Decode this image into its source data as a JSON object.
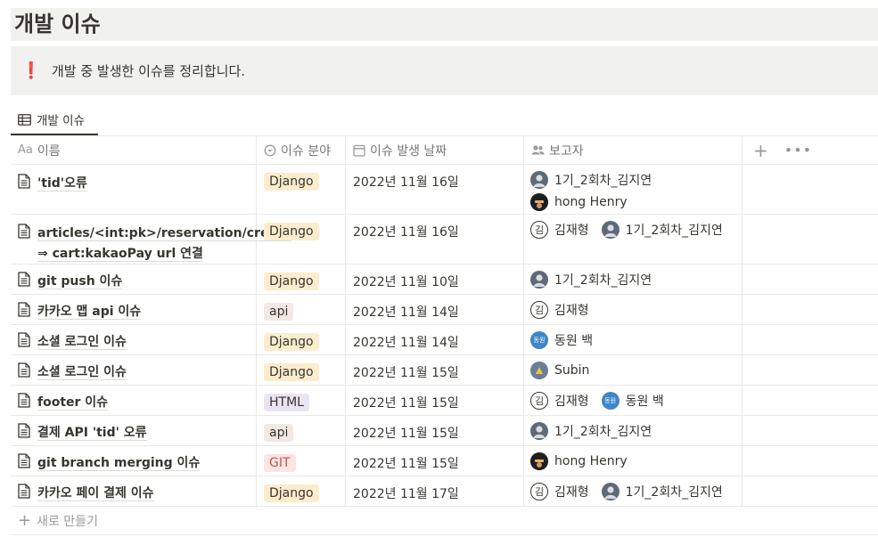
{
  "page": {
    "title": "개발 이슈"
  },
  "callout": {
    "emoji": "❗",
    "text": "개발 중 발생한 이슈를 정리합니다."
  },
  "view_tab": {
    "label": "개발 이슈"
  },
  "columns": {
    "name": "이름",
    "name_prefix": "Aa",
    "area": "이슈 분야",
    "date": "이슈 발생 날짜",
    "reporter": "보고자"
  },
  "tag_colors": {
    "Django": {
      "bg": "#fbeccd",
      "fg": "#37352f"
    },
    "api": {
      "bg": "#f2e8e4",
      "fg": "#37352f"
    },
    "HTML": {
      "bg": "#eae4f2",
      "fg": "#37352f"
    },
    "GIT": {
      "bg": "#fbe4e4",
      "fg": "#c4554d"
    }
  },
  "rows": [
    {
      "name": "'tid'오류",
      "area": "Django",
      "date": "2022년 11월 16일",
      "reporters": [
        "1기_2회차_김지연",
        "hong Henry"
      ],
      "vertical": true,
      "tall": true
    },
    {
      "name": "articles/<int:pk>/reservation/create ⇒ cart:kakaoPay url 연결",
      "area": "Django",
      "date": "2022년 11월 16일",
      "reporters": [
        "김재형",
        "1기_2회차_김지연"
      ],
      "tall": true
    },
    {
      "name": "git push 이슈",
      "area": "Django",
      "date": "2022년 11월 10일",
      "reporters": [
        "1기_2회차_김지연"
      ]
    },
    {
      "name": "카카오 맵 api 이슈",
      "area": "api",
      "date": "2022년 11월 14일",
      "reporters": [
        "김재형"
      ]
    },
    {
      "name": "소셜 로그인 이슈",
      "area": "Django",
      "date": "2022년 11월 14일",
      "reporters": [
        "동원 백"
      ]
    },
    {
      "name": "소셜 로그인 이슈",
      "area": "Django",
      "date": "2022년 11월 15일",
      "reporters": [
        "Subin"
      ]
    },
    {
      "name": "footer 이슈",
      "area": "HTML",
      "date": "2022년 11월 15일",
      "reporters": [
        "김재형",
        "동원 백"
      ]
    },
    {
      "name": "결제 API 'tid' 오류",
      "area": "api",
      "date": "2022년 11월 15일",
      "reporters": [
        "1기_2회차_김지연"
      ]
    },
    {
      "name": "git branch merging 이슈",
      "area": "GIT",
      "date": "2022년 11월 15일",
      "reporters": [
        "hong Henry"
      ]
    },
    {
      "name": "카카오 페이 결제 이슈",
      "area": "Django",
      "date": "2022년 11월 17일",
      "reporters": [
        "김재형",
        "1기_2회차_김지연"
      ]
    }
  ],
  "avatars": {
    "1기_2회차_김지연": {
      "kind": "user-silhouette",
      "letter": ""
    },
    "hong Henry": {
      "kind": "photo-dark",
      "letter": ""
    },
    "김재형": {
      "kind": "letter",
      "letter": "김"
    },
    "동원 백": {
      "kind": "initials-blue",
      "letter": "동원"
    },
    "Subin": {
      "kind": "photo",
      "letter": ""
    }
  },
  "add_row": {
    "label": "새로 만들기"
  }
}
